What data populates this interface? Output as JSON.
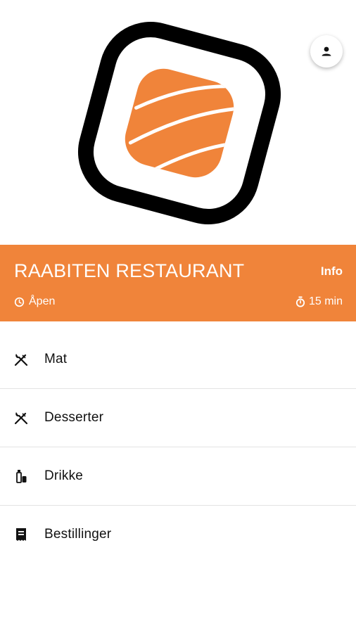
{
  "restaurant": {
    "name": "RAABITEN RESTAURANT",
    "info_label": "Info",
    "status": "Åpen",
    "delivery_time": "15 min"
  },
  "menu": {
    "items": [
      {
        "label": "Mat",
        "icon": "utensils-icon"
      },
      {
        "label": "Desserter",
        "icon": "utensils-icon"
      },
      {
        "label": "Drikke",
        "icon": "drink-icon"
      },
      {
        "label": "Bestillinger",
        "icon": "receipt-icon"
      }
    ]
  },
  "colors": {
    "accent": "#f0843a",
    "logo_outline": "#000000",
    "logo_fill": "#f0843a"
  }
}
